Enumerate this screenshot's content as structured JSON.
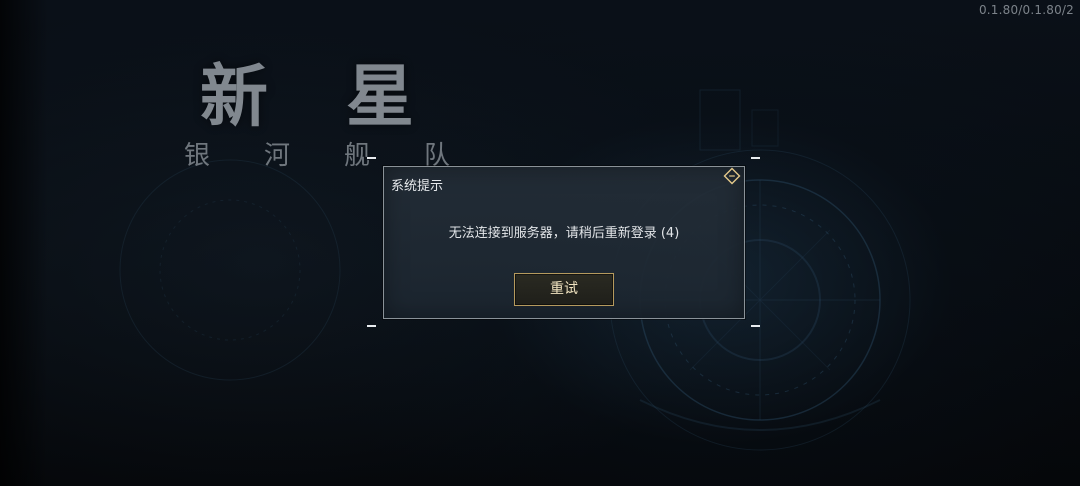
{
  "version_text": "0.1.80/0.1.80/2",
  "logo": {
    "title": "新星",
    "subtitle": "银河舰队"
  },
  "dialog": {
    "title": "系统提示",
    "message": "无法连接到服务器，请稍后重新登录 (4)",
    "retry_label": "重试",
    "close_icon": "diamond-close-icon"
  },
  "colors": {
    "background": "#070b10",
    "dialog_bg": "#1e2832",
    "dialog_border": "#8a9298",
    "button_border": "#b59a5e",
    "button_text": "#f0e3c0"
  }
}
